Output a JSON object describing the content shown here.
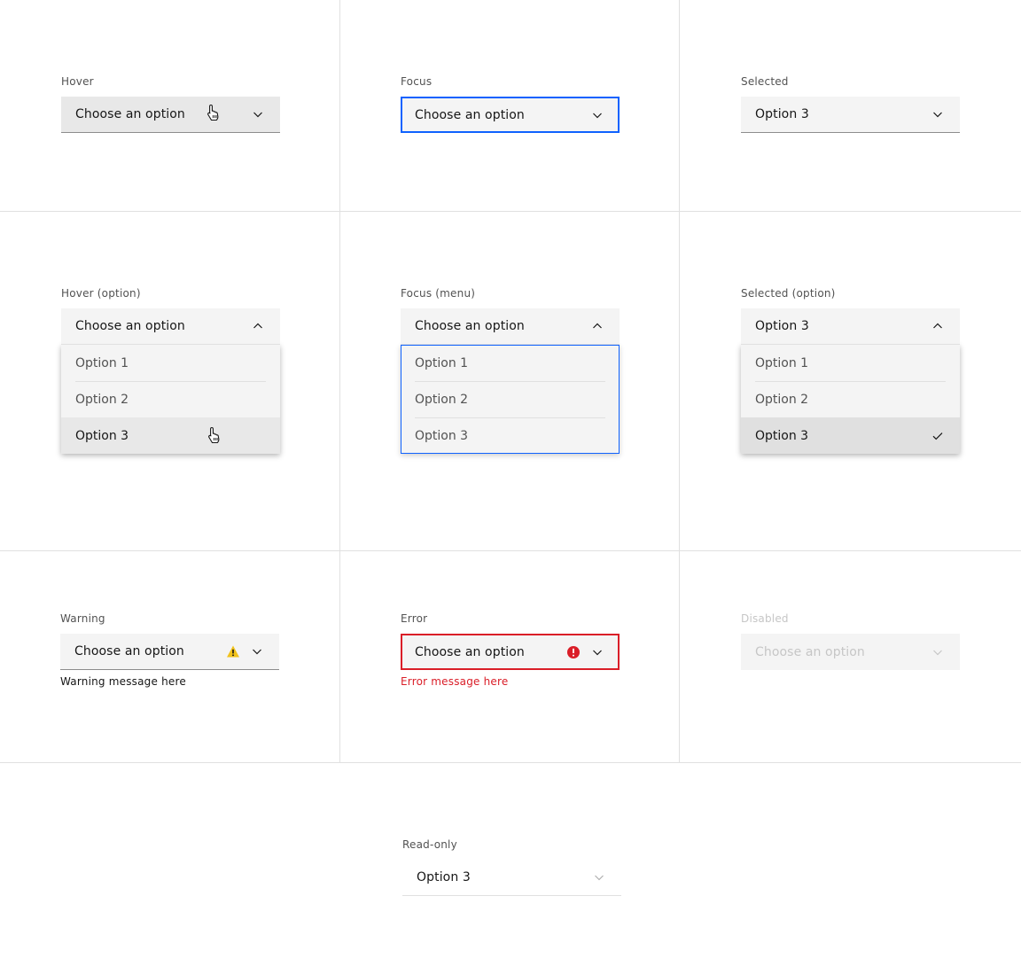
{
  "colors": {
    "focus": "#0f62fe",
    "error": "#da1e28",
    "warning": "#f1c21b",
    "field_bg": "#f4f4f4",
    "hover_bg": "#e8e8e8",
    "selected_bg": "#e0e0e0",
    "grid": "#e0e0e0"
  },
  "placeholder": "Choose an option",
  "options": [
    "Option 1",
    "Option 2",
    "Option 3"
  ],
  "states": {
    "hover": {
      "label": "Hover",
      "value": "Choose an option",
      "icon": "chevron-down-icon"
    },
    "focus": {
      "label": "Focus",
      "value": "Choose an option",
      "icon": "chevron-down-icon"
    },
    "selected": {
      "label": "Selected",
      "value": "Option 3",
      "icon": "chevron-down-icon"
    },
    "hover_option": {
      "label": "Hover (option)",
      "value": "Choose an option",
      "icon": "chevron-up-icon",
      "items": [
        "Option 1",
        "Option 2",
        "Option 3"
      ],
      "hovered_index": 2
    },
    "focus_menu": {
      "label": "Focus (menu)",
      "value": "Choose an option",
      "icon": "chevron-up-icon",
      "items": [
        "Option 1",
        "Option 2",
        "Option 3"
      ]
    },
    "selected_option": {
      "label": "Selected (option)",
      "value": "Option 3",
      "icon": "chevron-up-icon",
      "items": [
        "Option 1",
        "Option 2",
        "Option 3"
      ],
      "selected_index": 2
    },
    "warning": {
      "label": "Warning",
      "value": "Choose an option",
      "helper": "Warning message here",
      "status_icon": "warning-icon"
    },
    "error": {
      "label": "Error",
      "value": "Choose an option",
      "helper": "Error message here",
      "status_icon": "error-icon"
    },
    "disabled": {
      "label": "Disabled",
      "value": "Choose an option"
    },
    "readonly": {
      "label": "Read-only",
      "value": "Option 3"
    }
  }
}
